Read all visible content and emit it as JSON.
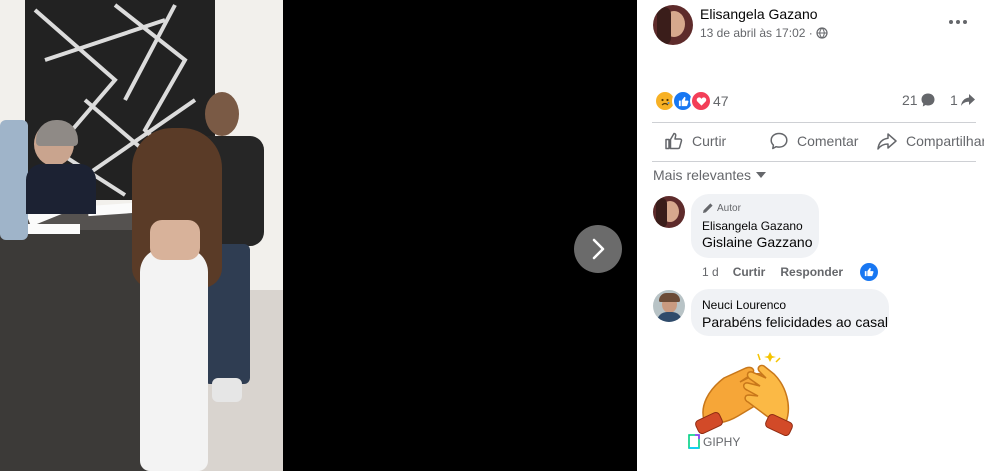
{
  "post": {
    "author": "Elisangela Gazano",
    "time": "13 de abril às 17:02 · ",
    "privacy_icon": "globe-icon"
  },
  "stats": {
    "reaction_icons": [
      "sad-reaction-icon",
      "like-reaction-icon",
      "love-reaction-icon"
    ],
    "reaction_count": "47",
    "comments_count": "21",
    "shares_count": "1"
  },
  "actions": {
    "like": "Curtir",
    "comment": "Comentar",
    "share": "Compartilhar"
  },
  "sort": {
    "label": "Mais relevantes"
  },
  "comments": [
    {
      "badge": "Autor",
      "name": "Elisangela Gazano",
      "text": "Gislaine Gazzano",
      "time": "1 d",
      "like": "Curtir",
      "reply": "Responder"
    },
    {
      "name": "Neuci Lourenco",
      "text": "Parabéns felicidades ao casal",
      "gif_label": "GIPHY"
    }
  ],
  "colors": {
    "accent": "#1877f2",
    "secondary_text": "#65676b",
    "bubble": "#f0f2f5",
    "love": "#f33e58",
    "sad": "#f7b125"
  }
}
